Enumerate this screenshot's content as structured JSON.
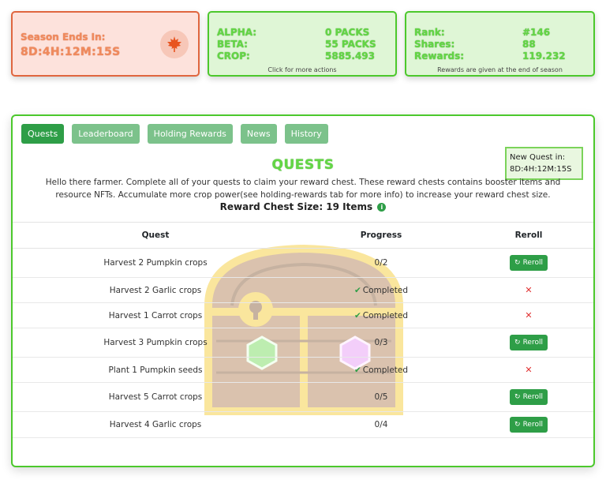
{
  "season": {
    "label": "Season Ends In:",
    "value": "8D:4H:12M:15S",
    "icon": "maple-leaf-icon"
  },
  "packs": {
    "rows": [
      {
        "label": "ALPHA:",
        "value": "0 PACKS"
      },
      {
        "label": "BETA:",
        "value": "55 PACKS"
      },
      {
        "label": "CROP:",
        "value": "5885.493"
      }
    ],
    "footer": "Click for more actions"
  },
  "shares": {
    "rows": [
      {
        "label": "Rank:",
        "value": "#146"
      },
      {
        "label": "Shares:",
        "value": "88"
      },
      {
        "label": "Rewards:",
        "value": "119.232"
      }
    ],
    "footer": "Rewards are given at the end of season"
  },
  "tabs": [
    "Quests",
    "Leaderboard",
    "Holding Rewards",
    "News",
    "History"
  ],
  "new_quest": {
    "label": "New Quest in:",
    "value": "8D:4H:12M:15S"
  },
  "quests_title": "QUESTS",
  "description": "Hello there farmer. Complete all of your quests to claim your reward chest. These reward chests contains booster items and resource NFTs. Accumulate more crop power(see holding-rewards tab for more info) to increase your reward chest size.",
  "chest_size": "Reward Chest Size: 19 Items",
  "table": {
    "headers": [
      "Quest",
      "Progress",
      "Reroll"
    ],
    "reroll_label": "Reroll",
    "rows": [
      {
        "quest": "Harvest 2 Pumpkin crops",
        "progress": "0/2",
        "completed": false
      },
      {
        "quest": "Harvest 2 Garlic crops",
        "progress": "Completed",
        "completed": true
      },
      {
        "quest": "Harvest 1 Carrot crops",
        "progress": "Completed",
        "completed": true
      },
      {
        "quest": "Harvest 3 Pumpkin crops",
        "progress": "0/3",
        "completed": false
      },
      {
        "quest": "Plant 1 Pumpkin seeds",
        "progress": "Completed",
        "completed": true
      },
      {
        "quest": "Harvest 5 Carrot crops",
        "progress": "0/5",
        "completed": false
      },
      {
        "quest": "Harvest 4 Garlic crops",
        "progress": "0/4",
        "completed": false
      }
    ]
  },
  "colors": {
    "accent_green": "#2e9e47",
    "season_orange": "#e0663f",
    "card_border_green": "#4cc82c"
  }
}
